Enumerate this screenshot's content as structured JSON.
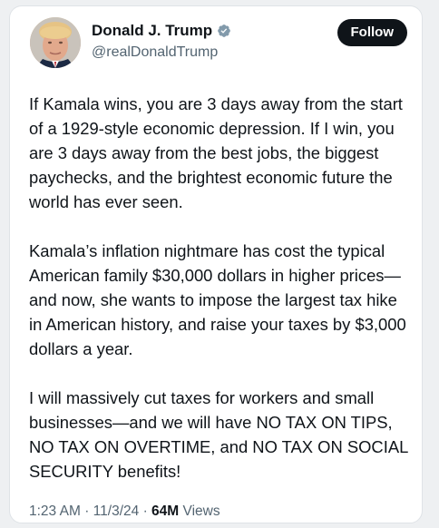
{
  "tweet": {
    "author": {
      "display_name": "Donald J. Trump",
      "handle": "@realDonaldTrump",
      "verified": true,
      "avatar_icon": "profile-photo"
    },
    "follow_label": "Follow",
    "paragraphs": [
      "If Kamala wins, you are 3 days away from the start of a 1929-style economic depression. If I win, you are 3 days away from the best jobs, the biggest paychecks, and the brightest economic future the world has ever seen.",
      "Kamala’s inflation nightmare has cost the typical American family $30,000 dollars in higher prices—and now, she wants to impose the largest tax hike in American history, and raise your taxes by $3,000 dollars a year.",
      "I will massively cut taxes for workers and small businesses—and we will have NO TAX ON TIPS, NO TAX ON OVERTIME, and NO TAX ON SOCIAL SECURITY benefits!"
    ],
    "meta": {
      "time": "1:23 AM",
      "date": "11/3/24",
      "separator": "·",
      "views_count": "64M",
      "views_label": "Views"
    }
  },
  "colors": {
    "text_primary": "#0f1419",
    "text_secondary": "#536471",
    "verified_badge": "#829aab",
    "follow_button_bg": "#0f1419"
  }
}
